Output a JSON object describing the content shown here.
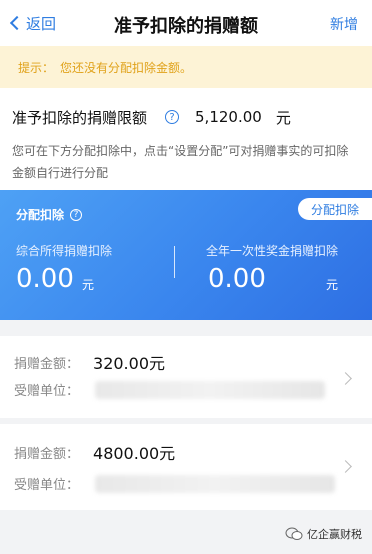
{
  "nav": {
    "back_label": "返回",
    "title": "准予扣除的捐赠额",
    "add_label": "新增"
  },
  "tip": {
    "label": "提示：",
    "text": "您还没有分配扣除金额。"
  },
  "limit": {
    "label": "准予扣除的捐赠限额",
    "value": "5,120.00",
    "unit": "元",
    "desc": "您可在下方分配扣除中，点击“设置分配”可对捐赠事实的可扣除金额自行进行分配"
  },
  "allocation": {
    "title": "分配扣除",
    "button_label": "分配扣除",
    "left": {
      "label": "综合所得捐赠扣除",
      "value": "0.00",
      "unit": "元"
    },
    "right": {
      "label": "全年一次性奖金捐赠扣除",
      "value": "0.00",
      "unit": "元"
    }
  },
  "donations": [
    {
      "amount_label": "捐赠金额：",
      "amount": "320.00元",
      "unit_label": "受赠单位："
    },
    {
      "amount_label": "捐赠金额：",
      "amount": "4800.00元",
      "unit_label": "受赠单位："
    }
  ],
  "watermark": {
    "text": "亿企赢财税"
  },
  "colors": {
    "accent": "#2f7de1",
    "tip_bg": "#fdf3d6",
    "tip_text": "#e0a21a",
    "panel_blue": "#3a86ee"
  }
}
